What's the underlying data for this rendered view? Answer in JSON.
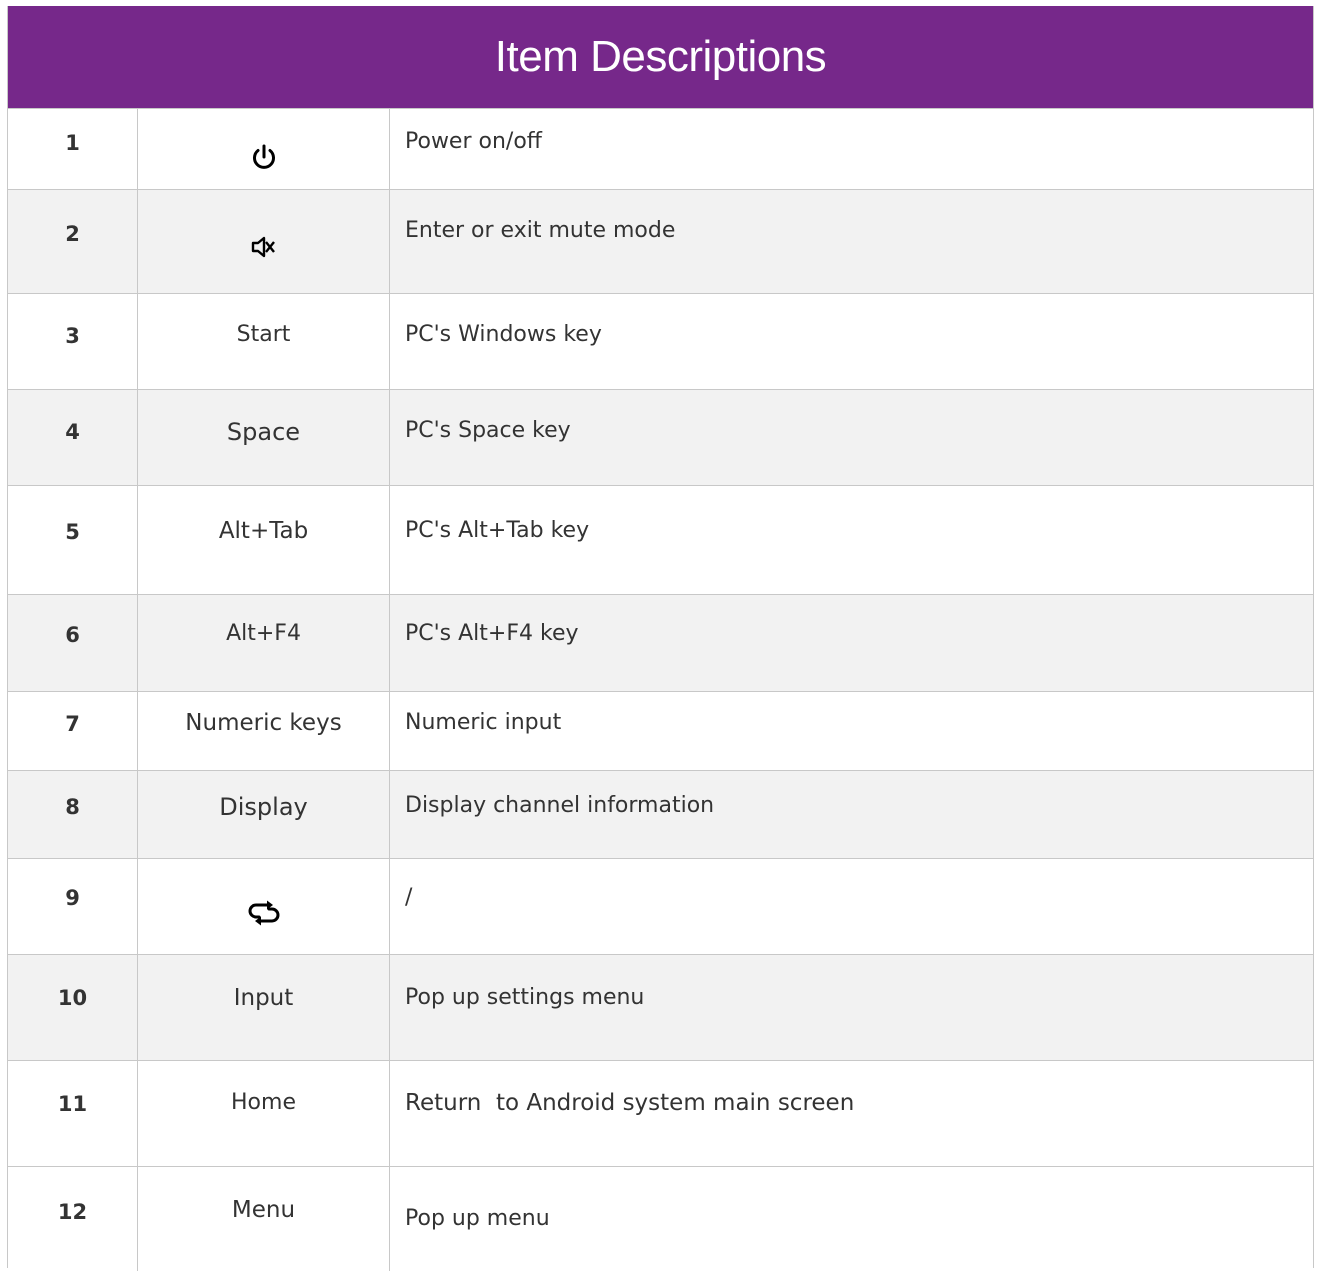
{
  "header": {
    "title": "Item Descriptions"
  },
  "icons": {
    "row1": "power-icon",
    "row2": "mute-icon",
    "row9": "repeat-icon"
  },
  "rows": [
    {
      "num": "1",
      "key": "",
      "desc": "Power on/off"
    },
    {
      "num": "2",
      "key": "",
      "desc": "Enter or exit mute mode"
    },
    {
      "num": "3",
      "key": "Start",
      "desc": "PC's Windows key"
    },
    {
      "num": "4",
      "key": "Space",
      "desc": "PC's Space key"
    },
    {
      "num": "5",
      "key": "Alt+Tab",
      "desc": "PC's Alt+Tab key"
    },
    {
      "num": "6",
      "key": "Alt+F4",
      "desc": "PC's Alt+F4 key"
    },
    {
      "num": "7",
      "key": "Numeric keys",
      "desc": "Numeric input"
    },
    {
      "num": "8",
      "key": "Display",
      "desc": "Display channel information"
    },
    {
      "num": "9",
      "key": "",
      "desc": "/"
    },
    {
      "num": "10",
      "key": "Input",
      "desc": "Pop up settings menu"
    },
    {
      "num": "11",
      "key": "Home",
      "desc": "Return  to Android system main screen"
    },
    {
      "num": "12",
      "key": "Menu",
      "desc": "Pop up menu"
    }
  ]
}
